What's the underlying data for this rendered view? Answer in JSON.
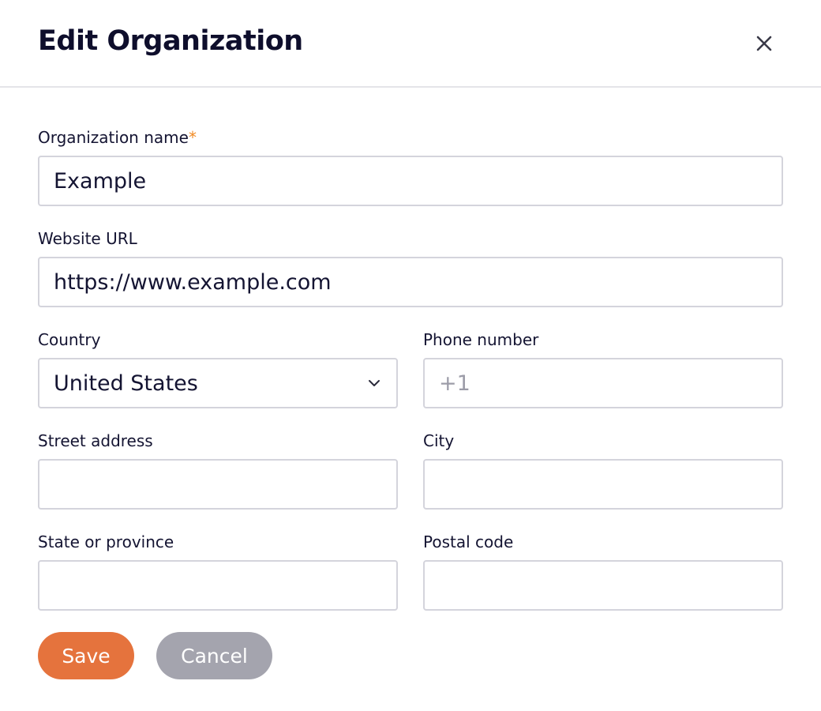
{
  "dialog": {
    "title": "Edit Organization",
    "close_icon": "close-icon"
  },
  "form": {
    "organization_name": {
      "label": "Organization name",
      "required_marker": "*",
      "value": "Example"
    },
    "website_url": {
      "label": "Website URL",
      "value": "https://www.example.com"
    },
    "country": {
      "label": "Country",
      "selected": "United States",
      "icon": "chevron-down-icon"
    },
    "phone_number": {
      "label": "Phone number",
      "placeholder": "+1"
    },
    "street_address": {
      "label": "Street address",
      "value": ""
    },
    "city": {
      "label": "City",
      "value": ""
    },
    "state_or_province": {
      "label": "State or province",
      "value": ""
    },
    "postal_code": {
      "label": "Postal code",
      "value": ""
    }
  },
  "actions": {
    "save_label": "Save",
    "cancel_label": "Cancel"
  },
  "colors": {
    "primary": "#e5733d",
    "secondary": "#a4a4ae",
    "required": "#f08a24"
  }
}
